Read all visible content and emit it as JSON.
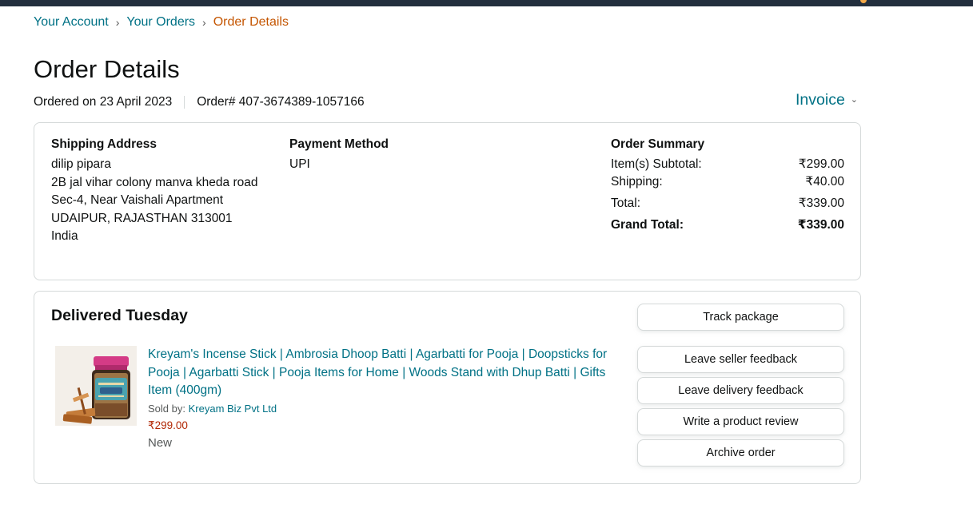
{
  "breadcrumb": {
    "items": [
      "Your Account",
      "Your Orders"
    ],
    "current": "Order Details",
    "separator": "›"
  },
  "page_title": "Order Details",
  "order": {
    "ordered_on": "Ordered on 23 April 2023",
    "order_number": "Order# 407-3674389-1057166"
  },
  "invoice": {
    "label": "Invoice",
    "icon": "chevron-down-icon"
  },
  "shipping": {
    "heading": "Shipping Address",
    "lines": [
      "dilip pipara",
      "2B jal vihar colony manva kheda road",
      "Sec-4, Near Vaishali Apartment",
      "UDAIPUR, RAJASTHAN 313001",
      "India"
    ]
  },
  "payment": {
    "heading": "Payment Method",
    "method": "UPI"
  },
  "summary": {
    "heading": "Order Summary",
    "rows": [
      {
        "label": "Item(s) Subtotal:",
        "value": "₹299.00"
      },
      {
        "label": "Shipping:",
        "value": "₹40.00"
      },
      {
        "label": "Total:",
        "value": "₹339.00"
      },
      {
        "label": "Grand Total:",
        "value": "₹339.00"
      }
    ]
  },
  "delivery": {
    "status": "Delivered Tuesday",
    "product": {
      "title": "Kreyam's Incense Stick | Ambrosia Dhoop Batti | Agarbatti for Pooja | Doopsticks for Pooja | Agarbatti Stick | Pooja Items for Home | Woods Stand with Dhup Batti | Gifts Item (400gm)",
      "sold_by_label": "Sold by:",
      "seller": "Kreyam Biz Pvt Ltd",
      "price": "₹299.00",
      "condition": "New"
    },
    "actions": {
      "track": "Track package",
      "seller_feedback": "Leave seller feedback",
      "delivery_feedback": "Leave delivery feedback",
      "review": "Write a product review",
      "archive": "Archive order"
    }
  },
  "colors": {
    "link": "#007185",
    "breadcrumb_current": "#c45500",
    "price": "#b12704",
    "header_bar": "#232f3e",
    "border": "#d5d9d9"
  }
}
